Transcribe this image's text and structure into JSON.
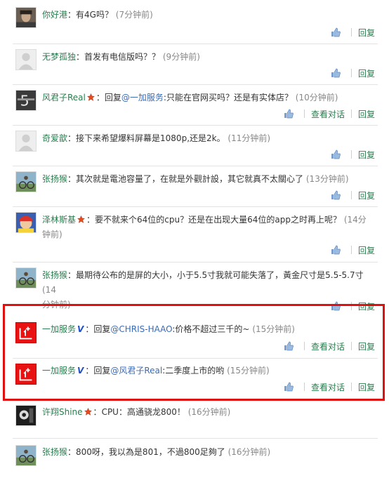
{
  "comments": [
    {
      "user": "你好港",
      "badge": "",
      "body_prefix": "",
      "mention": "",
      "body": "有4G吗？",
      "time": "(7分钟前)",
      "time_wrap": "",
      "actions": [
        "回复"
      ]
    },
    {
      "user": "无梦孤独",
      "badge": "",
      "body_prefix": "",
      "mention": "",
      "body": "首发有电信版吗？？",
      "time": "(9分钟前)",
      "time_wrap": "",
      "actions": [
        "回复"
      ]
    },
    {
      "user": "风君子Real",
      "badge": "crown",
      "body_prefix": "回复",
      "mention": "@一加服务",
      "body": ":只能在官网买吗？还是有实体店？",
      "time": "(10分钟前)",
      "time_wrap": "",
      "actions": [
        "查看对话",
        "回复"
      ]
    },
    {
      "user": "奇爱歆",
      "badge": "",
      "body_prefix": "",
      "mention": "",
      "body": "接下来希望爆料屏幕是1080p,还是2k。",
      "time": "(11分钟前)",
      "time_wrap": "",
      "actions": [
        "回复"
      ]
    },
    {
      "user": "张扬猴",
      "badge": "",
      "body_prefix": "",
      "mention": "",
      "body": "其次就是電池容量了，在就是外觀計設，其它就真不太關心了",
      "time": "(13分钟前)",
      "time_wrap": "",
      "actions": [
        "回复"
      ]
    },
    {
      "user": "泽林斯基",
      "badge": "crown",
      "body_prefix": "",
      "mention": "",
      "body": "要不就来个64位的cpu？还是在出现大量64位的app之时再上呢？",
      "time": "(14分",
      "time_wrap": "钟前)",
      "actions": [
        "回复"
      ]
    },
    {
      "user": "张扬猴",
      "badge": "",
      "body_prefix": "",
      "mention": "",
      "body": "最期待公布的是屏的大小，小于5.5寸我就可能失落了，黃金尺寸是5.5-5.7寸",
      "time": "(14",
      "time_wrap": "分钟前)",
      "actions": [
        "回复"
      ]
    },
    {
      "user": "一加服务",
      "badge": "V",
      "body_prefix": "回复",
      "mention": "@CHRIS-HAAO",
      "body": ":价格不超过三千的~",
      "time": "(15分钟前)",
      "time_wrap": "",
      "actions": [
        "查看对话",
        "回复"
      ]
    },
    {
      "user": "一加服务",
      "badge": "V",
      "body_prefix": "回复",
      "mention": "@风君子Real",
      "body": ":二季度上市的哟",
      "time": "(15分钟前)",
      "time_wrap": "",
      "actions": [
        "查看对话",
        "回复"
      ]
    },
    {
      "user": "许翔Shine",
      "badge": "crown",
      "body_prefix": "",
      "mention": "",
      "body": "CPU：高通骁龙800！",
      "time": "(16分钟前)",
      "time_wrap": "",
      "actions": []
    },
    {
      "user": "张扬猴",
      "badge": "",
      "body_prefix": "",
      "mention": "",
      "body": "800呀，我以為是801，不過800足夠了",
      "time": "(16分钟前)",
      "time_wrap": "",
      "actions": []
    }
  ],
  "colors": {
    "username": "#2b7d4f",
    "mention": "#3a6bb5",
    "highlight": "#e01010",
    "brand": "#e81212"
  }
}
